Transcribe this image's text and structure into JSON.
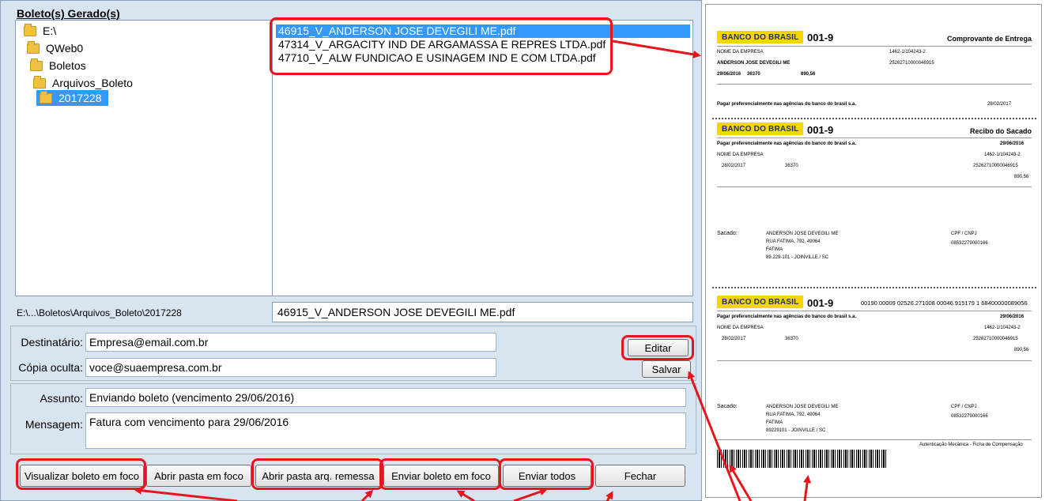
{
  "window": {
    "panel_title": "Boleto(s) Gerado(s)",
    "tree": [
      {
        "label": "E:\\"
      },
      {
        "label": "QWeb0"
      },
      {
        "label": "Boletos"
      },
      {
        "label": "Arquivos_Boleto"
      },
      {
        "label": "2017228",
        "selected": true
      }
    ],
    "files": [
      {
        "label": "46915_V_ANDERSON JOSE DEVEGILI ME.pdf",
        "selected": true
      },
      {
        "label": "47314_V_ARGACITY IND DE ARGAMASSA E REPRES LTDA.pdf"
      },
      {
        "label": "47710_V_ALW FUNDICAO E USINAGEM IND E COM LTDA.pdf"
      }
    ],
    "path_label": "E:\\...\\Boletos\\Arquivos_Boleto\\2017228",
    "selected_filename": "46915_V_ANDERSON JOSE DEVEGILI ME.pdf",
    "form": {
      "destinatario_label": "Destinatário:",
      "destinatario_value": "Empresa@email.com.br",
      "copia_label": "Cópia oculta:",
      "copia_value": "voce@suaempresa.com.br",
      "assunto_label": "Assunto:",
      "assunto_value": "Enviando boleto (vencimento 29/06/2016)",
      "mensagem_label": "Mensagem:",
      "mensagem_value": "Fatura com vencimento para 29/06/2016"
    },
    "buttons": {
      "editar": "Editar",
      "salvar": "Salvar",
      "visualizar": "Visualizar boleto em foco",
      "abrir_pasta": "Abrir pasta em foco",
      "abrir_remessa": "Abrir pasta arq. remessa",
      "enviar_boleto": "Enviar boleto em foco",
      "enviar_todos": "Enviar todos",
      "fechar": "Fechar"
    }
  },
  "boleto_preview": {
    "bank_logo": "BANCO DO BRASIL",
    "bank_code": "001-9",
    "section1_title": "Comprovante de Entrega",
    "section2_title": "Recibo do Sacado",
    "digitable_line": "00190.00009 02526.271008 00046.915179 1 68400000089056",
    "cedente": "NOME DA EMPRESA",
    "sacado": "ANDERSON JOSE DEVEGILI ME",
    "address1": "RUA FATIMA, 792, 49064",
    "address2": "FATIMA",
    "address3": "89.229-101 - JOINVILLE / SC",
    "address3b": "89229101 - JOINVILLE / SC",
    "vencimento": "29/06/2016",
    "data_documento": "28/02/2017",
    "numero_documento": "36370",
    "agencia": "1462-1/104243-2",
    "nosso_numero": "25262710000046915",
    "valor": "890,56",
    "cnpj": "08532279000166",
    "local_pagamento": "Pagar preferencialmente nas agências do banco do brasil s.a.",
    "cpf_label": "CPF / CNPJ",
    "sacado_label": "Sacado:",
    "aut_mecanica": "Autenticação Mecânica - Ficha de Compensação"
  },
  "colors": {
    "window_bg": "#d9e4f1",
    "selection": "#3399ff",
    "highlight": "#e8161c",
    "bank_yellow": "#f5d600"
  }
}
